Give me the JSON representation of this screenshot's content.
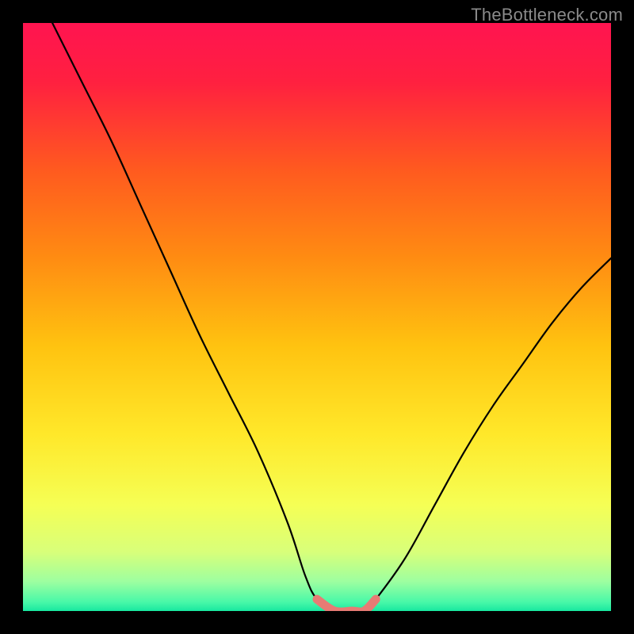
{
  "watermark": "TheBottleneck.com",
  "gradient_stops": [
    {
      "offset": 0.0,
      "color": "#ff1450"
    },
    {
      "offset": 0.1,
      "color": "#ff2040"
    },
    {
      "offset": 0.25,
      "color": "#ff5a1f"
    },
    {
      "offset": 0.4,
      "color": "#ff8c12"
    },
    {
      "offset": 0.55,
      "color": "#ffc310"
    },
    {
      "offset": 0.7,
      "color": "#ffe82a"
    },
    {
      "offset": 0.82,
      "color": "#f5ff55"
    },
    {
      "offset": 0.9,
      "color": "#d8ff7a"
    },
    {
      "offset": 0.95,
      "color": "#9dffa0"
    },
    {
      "offset": 0.985,
      "color": "#48f8a8"
    },
    {
      "offset": 1.0,
      "color": "#18e8a0"
    }
  ],
  "chart_data": {
    "type": "line",
    "title": "",
    "xlabel": "",
    "ylabel": "",
    "xlim": [
      0,
      100
    ],
    "ylim": [
      0,
      100
    ],
    "series": [
      {
        "name": "bottleneck-curve",
        "x": [
          5,
          10,
          15,
          20,
          25,
          30,
          35,
          40,
          45,
          48,
          50,
          53,
          56,
          58,
          60,
          65,
          70,
          75,
          80,
          85,
          90,
          95,
          100
        ],
        "y": [
          100,
          90,
          80,
          69,
          58,
          47,
          37,
          27,
          15,
          6,
          2,
          0,
          0,
          0,
          2,
          9,
          18,
          27,
          35,
          42,
          49,
          55,
          60
        ]
      }
    ],
    "highlight_segment": {
      "name": "bottom-flat",
      "color": "#e77b74",
      "x": [
        50,
        53,
        56,
        58,
        60
      ],
      "y": [
        2,
        0,
        0,
        0,
        2
      ]
    }
  }
}
